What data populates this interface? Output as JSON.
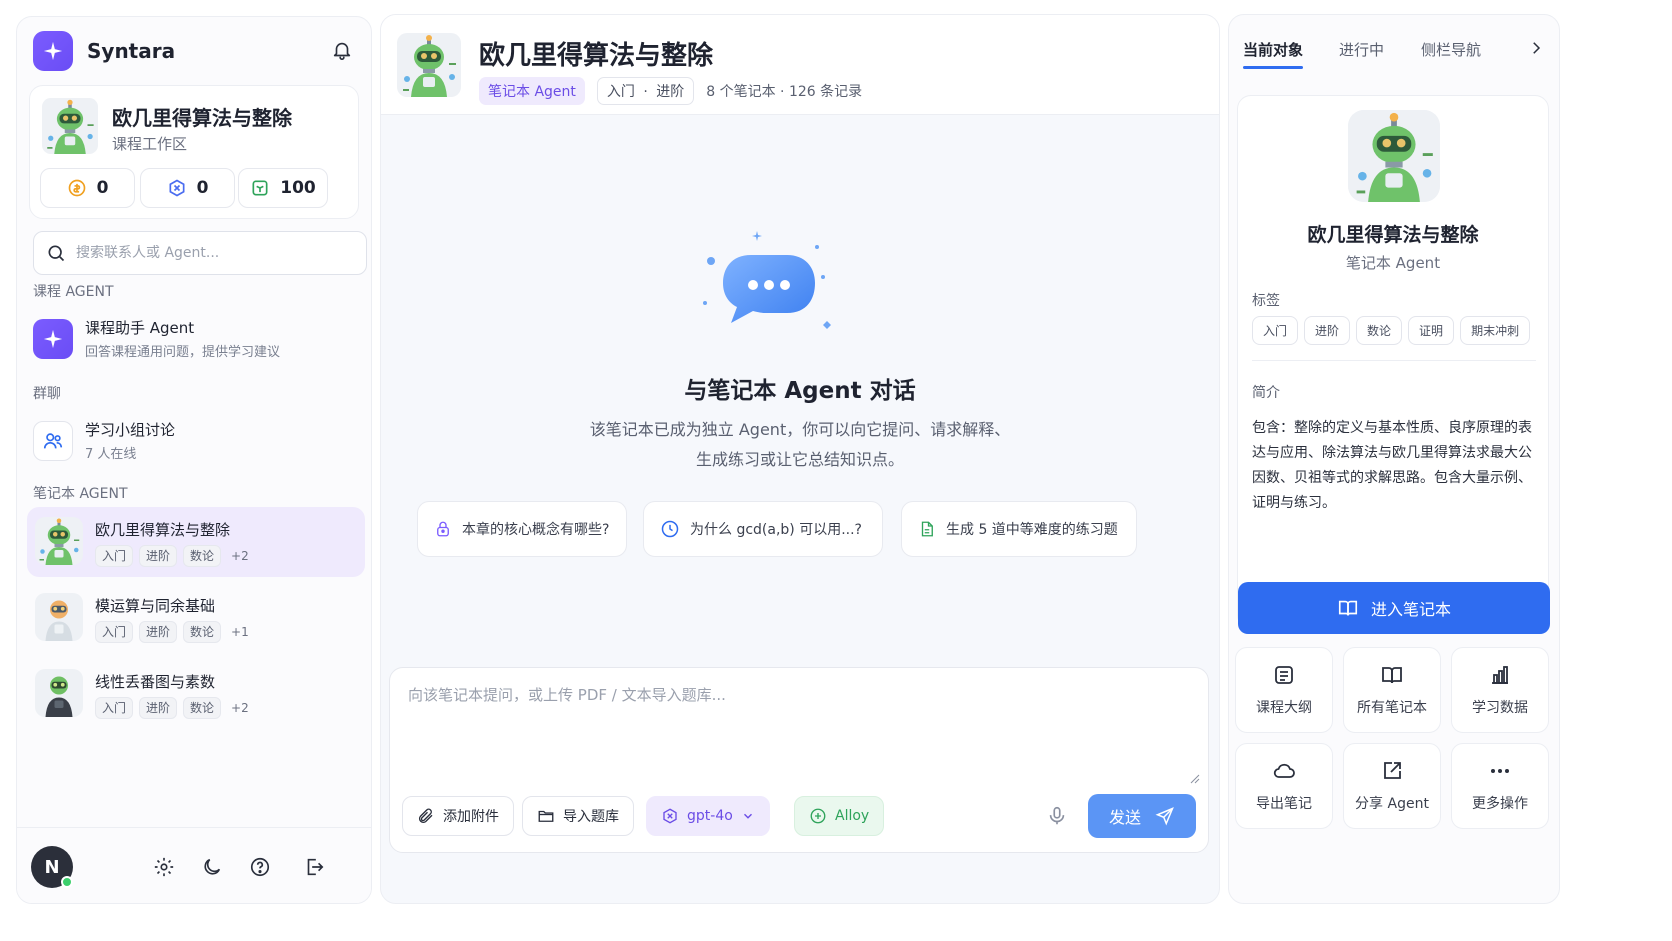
{
  "app": {
    "brand_name": "Syntara",
    "accent": "#6a4df5",
    "primary_blue": "#2f6cf0"
  },
  "sidebar": {
    "workspace": {
      "title": "欧几里得算法与整除",
      "subtitle": "课程工作区",
      "stats": [
        {
          "icon": "coin-icon",
          "value": "0"
        },
        {
          "icon": "gem-icon",
          "value": "0"
        },
        {
          "icon": "cube-icon",
          "value": "100"
        }
      ]
    },
    "search_placeholder": "搜索联系人或 Agent...",
    "sections": {
      "course_agent": "课程 AGENT",
      "group_chat": "群聊",
      "notebook_agent": "笔记本 AGENT"
    },
    "course_agent": {
      "title": "课程助手 Agent",
      "subtitle": "回答课程通用问题，提供学习建议"
    },
    "group": {
      "title": "学习小组讨论",
      "subtitle": "7 人在线"
    },
    "notebooks": [
      {
        "title": "欧几里得算法与整除",
        "tags": [
          "入门",
          "进阶",
          "数论"
        ],
        "more": "+2",
        "active": true
      },
      {
        "title": "模运算与同余基础",
        "tags": [
          "入门",
          "进阶",
          "数论"
        ],
        "more": "+1",
        "active": false
      },
      {
        "title": "线性丢番图与素数",
        "tags": [
          "入门",
          "进阶",
          "数论"
        ],
        "more": "+2",
        "active": false
      }
    ],
    "user_initial": "N"
  },
  "center": {
    "title": "欧几里得算法与整除",
    "badge": "笔记本 Agent",
    "level_a": "入门",
    "level_b": "进阶",
    "level_sep": "·",
    "meta": "8 个笔记本 · 126 条记录",
    "hero_title": "与笔记本 Agent 对话",
    "hero_line1": "该笔记本已成为独立 Agent，你可以向它提问、请求解释、",
    "hero_line2": "生成练习或让它总结知识点。",
    "suggestions": [
      {
        "icon": "lock-icon",
        "label": "本章的核心概念有哪些?"
      },
      {
        "icon": "clock-icon",
        "label": "为什么 gcd(a,b) 可以用...?"
      },
      {
        "icon": "file-icon",
        "label": "生成 5 道中等难度的练习题"
      }
    ],
    "composer": {
      "placeholder": "向该笔记本提问，或上传 PDF / 文本导入题库...",
      "attach_label": "添加附件",
      "import_label": "导入题库",
      "model_label": "gpt-4o",
      "voice_label": "Alloy",
      "send_label": "发送"
    }
  },
  "right": {
    "tabs": [
      "当前对象",
      "进行中",
      "侧栏导航"
    ],
    "object": {
      "title": "欧几里得算法与整除",
      "subtitle": "笔记本 Agent",
      "tags_label": "标签",
      "tags": [
        "入门",
        "进阶",
        "数论",
        "证明",
        "期末冲刺"
      ],
      "intro_label": "简介",
      "intro": "包含：整除的定义与基本性质、良序原理的表达与应用、除法算法与欧几里得算法求最大公因数、贝祖等式的求解思路。包含大量示例、证明与练习。",
      "enter_label": "进入笔记本"
    },
    "actions": [
      {
        "icon": "outline-icon",
        "label": "课程大纲"
      },
      {
        "icon": "book-icon",
        "label": "所有笔记本"
      },
      {
        "icon": "chart-icon",
        "label": "学习数据"
      },
      {
        "icon": "cloud-icon",
        "label": "导出笔记"
      },
      {
        "icon": "share-icon",
        "label": "分享 Agent"
      },
      {
        "icon": "more-icon",
        "label": "更多操作"
      }
    ]
  }
}
